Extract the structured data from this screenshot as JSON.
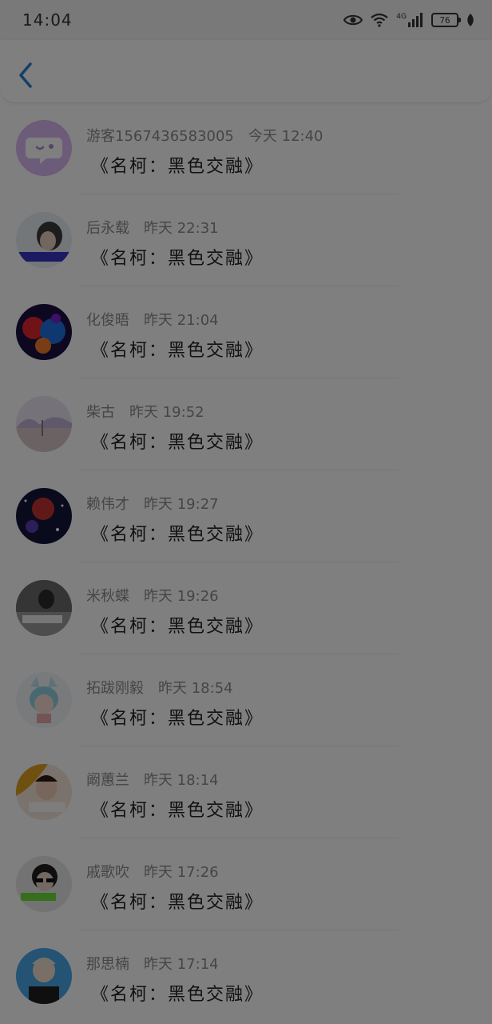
{
  "status_bar": {
    "time": "14:04",
    "network": "4G",
    "battery": "76"
  },
  "comments": [
    {
      "user": "游客1567436583005",
      "time": "今天 12:40",
      "message": "《名柯：黑色交融》",
      "avatar": "chat-bubble-avatar"
    },
    {
      "user": "后永载",
      "time": "昨天 22:31",
      "message": "《名柯：黑色交融》",
      "avatar": "user-avatar"
    },
    {
      "user": "化俊晤",
      "time": "昨天 21:04",
      "message": "《名柯：黑色交融》",
      "avatar": "user-avatar"
    },
    {
      "user": "柴古",
      "time": "昨天 19:52",
      "message": "《名柯：黑色交融》",
      "avatar": "user-avatar"
    },
    {
      "user": "赖伟才",
      "time": "昨天 19:27",
      "message": "《名柯：黑色交融》",
      "avatar": "user-avatar"
    },
    {
      "user": "米秋蝶",
      "time": "昨天 19:26",
      "message": "《名柯：黑色交融》",
      "avatar": "user-avatar"
    },
    {
      "user": "拓跋刚毅",
      "time": "昨天 18:54",
      "message": "《名柯：黑色交融》",
      "avatar": "user-avatar"
    },
    {
      "user": "阚蕙兰",
      "time": "昨天 18:14",
      "message": "《名柯：黑色交融》",
      "avatar": "user-avatar"
    },
    {
      "user": "戚歌吹",
      "time": "昨天 17:26",
      "message": "《名柯：黑色交融》",
      "avatar": "user-avatar"
    },
    {
      "user": "那思楠",
      "time": "昨天 17:14",
      "message": "《名柯：黑色交融》",
      "avatar": "user-avatar"
    }
  ],
  "colors": {
    "accent": "#2a7fd4",
    "overlay": "#000000"
  }
}
